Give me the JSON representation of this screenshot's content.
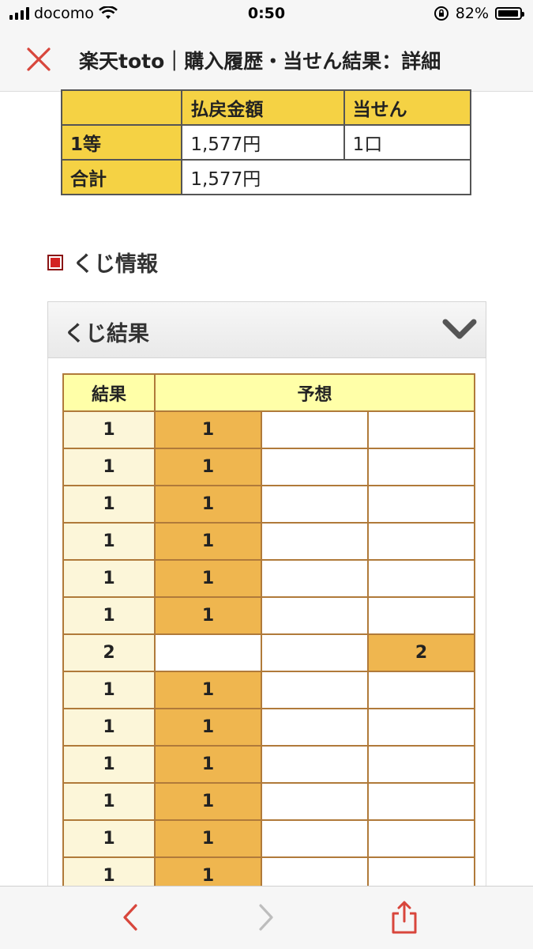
{
  "status_bar": {
    "carrier": "docomo",
    "time": "0:50",
    "battery": "82%",
    "battery_level": 0.82
  },
  "header": {
    "title": "楽天toto｜購入履歴・当せん結果：詳細"
  },
  "payout_table": {
    "headers": [
      "",
      "払戻金額",
      "当せん"
    ],
    "rows": [
      {
        "label": "1等",
        "amount": "1,577円",
        "count": "1口"
      },
      {
        "label": "合計",
        "amount": "1,577円"
      }
    ]
  },
  "section": {
    "title": "くじ情報"
  },
  "accordion": {
    "title": "くじ結果"
  },
  "results_table": {
    "headers": {
      "result": "結果",
      "prediction": "予想"
    },
    "rows": [
      {
        "result": "1",
        "picks": [
          "1",
          "",
          ""
        ]
      },
      {
        "result": "1",
        "picks": [
          "1",
          "",
          ""
        ]
      },
      {
        "result": "1",
        "picks": [
          "1",
          "",
          ""
        ]
      },
      {
        "result": "1",
        "picks": [
          "1",
          "",
          ""
        ]
      },
      {
        "result": "1",
        "picks": [
          "1",
          "",
          ""
        ]
      },
      {
        "result": "1",
        "picks": [
          "1",
          "",
          ""
        ]
      },
      {
        "result": "2",
        "picks": [
          "",
          "",
          "2"
        ]
      },
      {
        "result": "1",
        "picks": [
          "1",
          "",
          ""
        ]
      },
      {
        "result": "1",
        "picks": [
          "1",
          "",
          ""
        ]
      },
      {
        "result": "1",
        "picks": [
          "1",
          "",
          ""
        ]
      },
      {
        "result": "1",
        "picks": [
          "1",
          "",
          ""
        ]
      },
      {
        "result": "1",
        "picks": [
          "1",
          "",
          ""
        ]
      },
      {
        "result": "1",
        "picks": [
          "1",
          "",
          ""
        ]
      }
    ]
  },
  "colors": {
    "accent_yellow": "#f5d244",
    "pick_highlight": "#efb64f",
    "close_red": "#d8463c",
    "share_red": "#d8463c"
  }
}
